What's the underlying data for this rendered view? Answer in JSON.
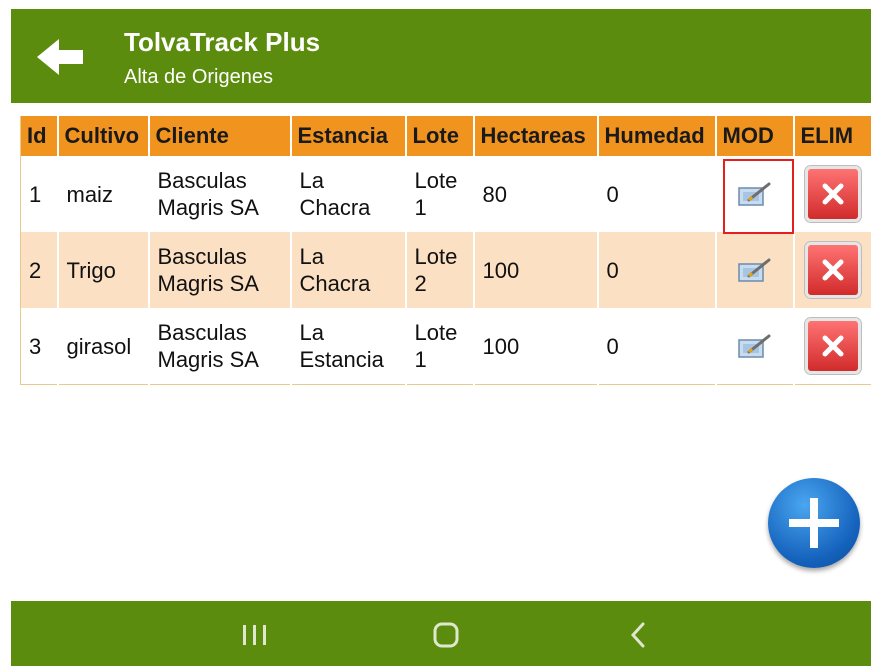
{
  "app": {
    "title": "TolvaTrack Plus",
    "subtitle": "Alta de Origenes"
  },
  "colors": {
    "appbar": "#5b8c0d",
    "header": "#f1931f",
    "row_alt": "#fbe0c3",
    "highlight": "#e51e1e",
    "fab": "#1563bd"
  },
  "table": {
    "headers": [
      "Id",
      "Cultivo",
      "Cliente",
      "Estancia",
      "Lote",
      "Hectareas",
      "Humedad",
      "MOD",
      "ELIM"
    ],
    "rows": [
      {
        "id": "1",
        "cultivo": "maiz",
        "cliente": [
          "Basculas",
          "Magris SA"
        ],
        "estancia": [
          "La",
          "Chacra"
        ],
        "lote": [
          "Lote",
          "1"
        ],
        "hectareas": "80",
        "humedad": "0"
      },
      {
        "id": "2",
        "cultivo": "Trigo",
        "cliente": [
          "Basculas",
          "Magris SA"
        ],
        "estancia": [
          "La",
          "Chacra"
        ],
        "lote": [
          "Lote",
          "2"
        ],
        "hectareas": "100",
        "humedad": "0"
      },
      {
        "id": "3",
        "cultivo": "girasol",
        "cliente": [
          "Basculas",
          "Magris SA"
        ],
        "estancia": [
          "La",
          "Estancia"
        ],
        "lote": [
          "Lote",
          "1"
        ],
        "hectareas": "100",
        "humedad": "0"
      }
    ]
  },
  "icons": {
    "back": "arrow-left-icon",
    "edit": "edit-icon",
    "delete": "delete-icon",
    "add": "plus-icon",
    "nav": [
      "recent-apps-icon",
      "home-icon",
      "back-nav-icon"
    ]
  }
}
